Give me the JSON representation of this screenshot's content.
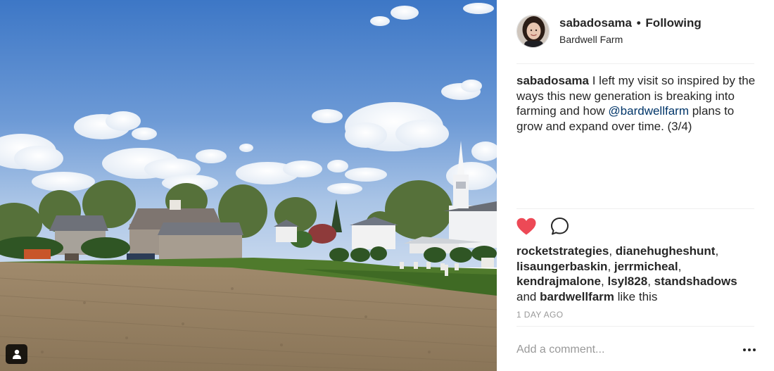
{
  "post": {
    "username": "sabadosama",
    "separator": "•",
    "follow_status": "Following",
    "location": "Bardwell Farm",
    "caption": {
      "author": "sabadosama",
      "text_before": " I left my visit so inspired by the ways this new generation is breaking into farming and how ",
      "mention": "@bardwellfarm",
      "text_after": " plans to grow and expand over time. (3/4)"
    },
    "likes": {
      "likers": [
        "rocketstrategies",
        "dianehugheshunt",
        "lisaungerbaskin",
        "jerrmicheal",
        "kendrajmalone",
        "lsyl828",
        "standshadows"
      ],
      "sep1": ", ",
      "and_word": "and ",
      "last_liker": "bardwellfarm",
      "suffix": " like this"
    },
    "timestamp": "1 DAY AGO"
  },
  "comment": {
    "placeholder": "Add a comment..."
  },
  "icons": {
    "like": "heart-icon",
    "comment": "speech-bubble-icon",
    "more": "ellipsis-icon",
    "user_tag": "person-icon"
  },
  "colors": {
    "heart": "#ed4956",
    "mention": "#003569",
    "muted": "#999999",
    "text": "#262626"
  }
}
